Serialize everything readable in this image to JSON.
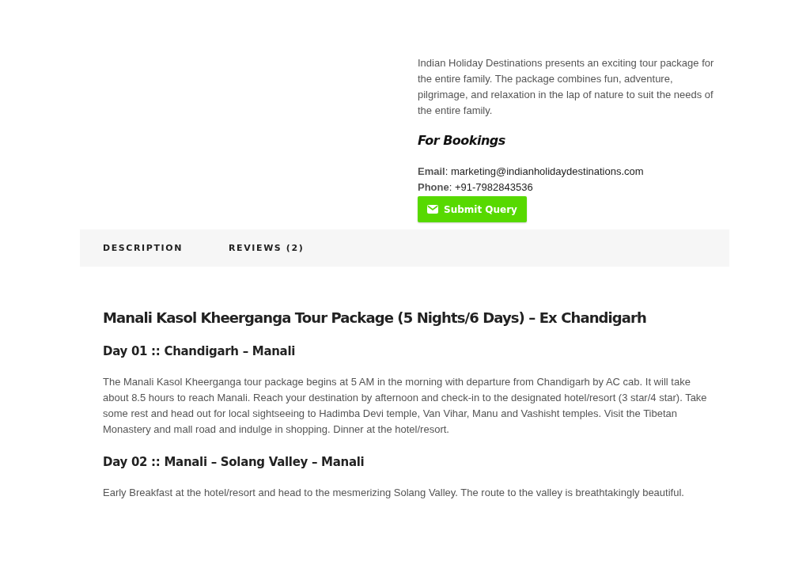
{
  "intro": "Indian Holiday Destinations presents an exciting tour package for the entire family. The package combines fun, adventure, pilgrimage, and relaxation in the lap of nature to suit the needs of the entire family.",
  "bookings_heading": "For Bookings",
  "contacts": [
    "**Email**: marketing@indianholidaydestinations.com",
    "**Phone**: +91-7982843536"
  ],
  "submit_button": "Submit Query",
  "tabs": [
    {
      "label": "DESCRIPTION"
    },
    {
      "label": "REVIEWS (2)"
    }
  ],
  "description": {
    "title": "Manali Kasol Kheerganga Tour Package (5 Nights/6 Days) – Ex Chandigarh",
    "days": [
      {
        "heading": "Day 01 :: Chandigarh – Manali",
        "text": "The Manali Kasol Kheerganga tour package begins at 5 AM in the morning with departure from Chandigarh by AC cab. It will take about 8.5 hours to reach Manali. Reach your destination by afternoon and check-in to the designated hotel/resort (3 star/4 star). Take some rest and head out for local sightseeing to Hadimba Devi temple, Van Vihar, Manu and Vashisht temples. Visit the Tibetan Monastery and mall road and indulge in shopping. Dinner at the hotel/resort."
      },
      {
        "heading": "Day 02 :: Manali – Solang Valley – Manali",
        "text": "Early Breakfast at the hotel/resort and head to the mesmerizing Solang Valley. The route to the valley is breathtakingly beautiful."
      }
    ]
  }
}
